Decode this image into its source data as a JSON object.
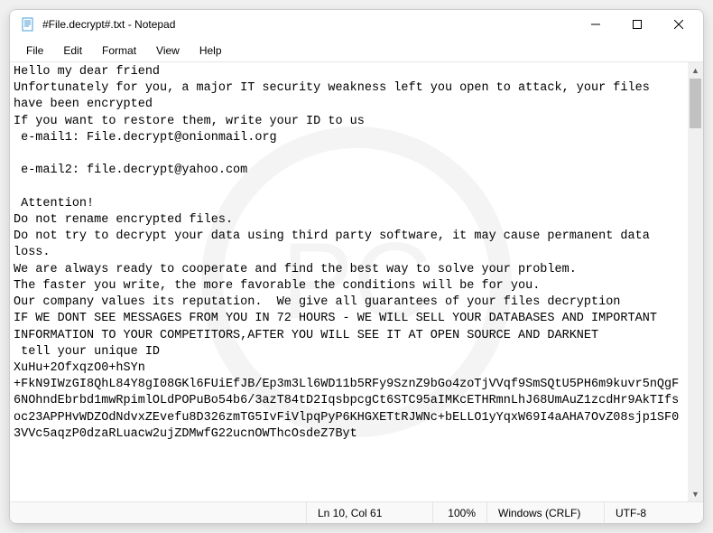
{
  "window": {
    "title": "#File.decrypt#.txt - Notepad"
  },
  "menu": {
    "file": "File",
    "edit": "Edit",
    "format": "Format",
    "view": "View",
    "help": "Help"
  },
  "content": "Hello my dear friend\nUnfortunately for you, a major IT security weakness left you open to attack, your files have been encrypted\nIf you want to restore them, write your ID to us\n e-mail1: File.decrypt@onionmail.org\n\n e-mail2: file.decrypt@yahoo.com\n\n Attention!\nDo not rename encrypted files.\nDo not try to decrypt your data using third party software, it may cause permanent data loss.\nWe are always ready to cooperate and find the best way to solve your problem.\nThe faster you write, the more favorable the conditions will be for you.\nOur company values its reputation.  We give all guarantees of your files decryption\nIF WE DONT SEE MESSAGES FROM YOU IN 72 HOURS - WE WILL SELL YOUR DATABASES AND IMPORTANT INFORMATION TO YOUR COMPETITORS,AFTER YOU WILL SEE IT AT OPEN SOURCE AND DARKNET\n tell your unique ID\nXuHu+2OfxqzO0+hSYn\n+FkN9IWzGI8QhL84Y8gI08GKl6FUiEfJB/Ep3m3Ll6WD11b5RFy9SznZ9bGo4zoTjVVqf9SmSQtU5PH6m9kuvr5nQgF6NOhndEbrbd1mwRpimlOLdPOPuBo54b6/3azT84tD2IqsbpcgCt6STC95aIMKcETHRmnLhJ68UmAuZ1zcdHr9AkTIfsoc23APPHvWDZOdNdvxZEvefu8D326zmTG5IvFiVlpqPyP6KHGXETtRJWNc+bELLO1yYqxW69I4aAHA7OvZ08sjp1SF03VVc5aqzP0dzaRLuacw2ujZDMwfG22ucnOWThcOsdeZ7Byt",
  "status": {
    "position": "Ln 10, Col 61",
    "zoom": "100%",
    "lineending": "Windows (CRLF)",
    "encoding": "UTF-8"
  }
}
